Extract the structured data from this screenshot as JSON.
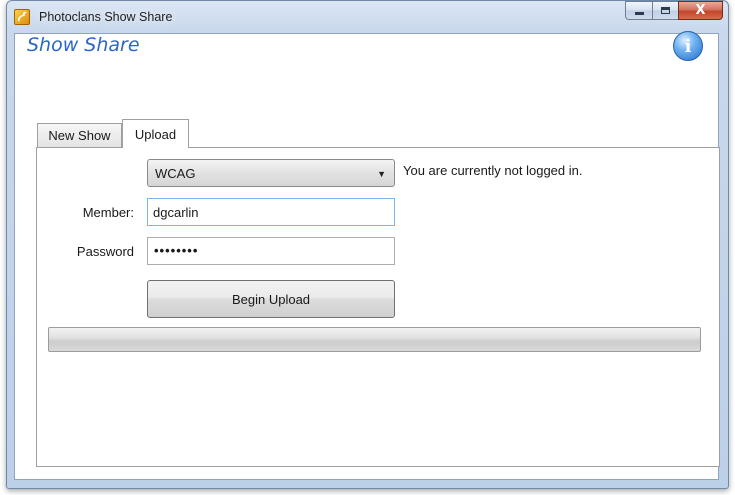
{
  "window": {
    "title": "Photoclans Show Share",
    "close_glyph": "X"
  },
  "app": {
    "heading": "Show Share",
    "info_icon_glyph": "i"
  },
  "tabs": [
    {
      "label": "New Show",
      "selected": false
    },
    {
      "label": "Upload",
      "selected": true
    }
  ],
  "upload": {
    "club_select": {
      "value": "WCAG",
      "options": [
        "WCAG"
      ]
    },
    "login_status": "You are currently not logged in.",
    "member_label": "Member:",
    "member_value": "dgcarlin",
    "password_label": "Password",
    "password_masked": "••••••••",
    "begin_upload_label": "Begin Upload",
    "progress_percent": 0
  },
  "colors": {
    "heading_blue": "#2a67c8",
    "close_red": "#c3462b"
  }
}
